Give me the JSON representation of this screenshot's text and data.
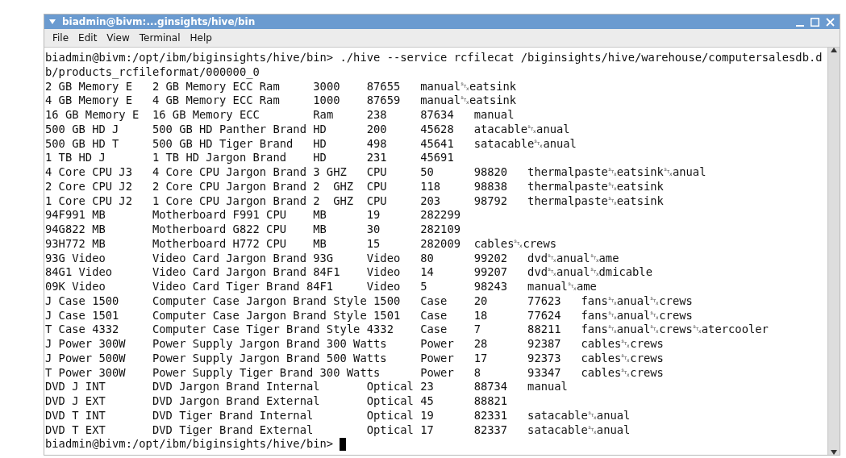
{
  "window": {
    "title": "biadmin@bivm:...ginsights/hive/bin"
  },
  "menu": [
    "File",
    "Edit",
    "View",
    "Terminal",
    "Help"
  ],
  "terminal": {
    "lines": [
      "biadmin@bivm:/opt/ibm/biginsights/hive/bin> ./hive --service rcfilecat /biginsights/hive/warehouse/computersalesdb.d",
      "b/products_rcfileformat/000000_0",
      "2 GB Memory E\t2 GB Memory ECC Ram\t3000\t87655\tmanual␂eatsink",
      "4 GB Memory E\t4 GB Memory ECC Ram\t1000\t87659\tmanual␂eatsink",
      "16 GB Memory E\t16 GB Memory ECC\tRam\t238\t87634\tmanual",
      "500 GB HD J\t500 GB HD Panther Brand\tHD\t200\t45628\tatacable␂anual",
      "500 GB HD T\t500 GB HD Tiger Brand\tHD\t498\t45641\tsatacable␂anual",
      "1 TB HD J\t1 TB HD Jargon Brand\tHD\t231\t45691",
      "4 Core CPU J3\t4 Core CPU Jargon Brand 3 GHZ\tCPU\t50\t98820\tthermalpaste␂eatsink␂anual",
      "2 Core CPU J2\t2 Core CPU Jargon Brand 2  GHZ\tCPU\t118\t98838\tthermalpaste␂eatsink",
      "1 Core CPU J2\t1 Core CPU Jargon Brand 2  GHZ\tCPU\t203\t98792\tthermalpaste␂eatsink",
      "94F991 MB\tMotherboard F991 CPU\tMB\t19\t282299",
      "94G822 MB\tMotherboard G822 CPU\tMB\t30\t282109",
      "93H772 MB\tMotherboard H772 CPU\tMB\t15\t282009\tcables␂crews",
      "93G Video\tVideo Card Jargon Brand 93G\tVideo\t80\t99202\tdvd␂anual␂ame",
      "84G1 Video\tVideo Card Jargon Brand 84F1\tVideo\t14\t99207\tdvd␂anual␂dmicable",
      "09K Video\tVideo Card Tiger Brand 84F1\tVideo\t5\t98243\tmanual␂ame",
      "J Case 1500\tComputer Case Jargon Brand Style 1500\tCase\t20\t77623\tfans␂anual␂crews",
      "J Case 1501\tComputer Case Jargon Brand Style 1501\tCase\t18\t77624\tfans␂anual␂crews",
      "T Case 4332\tComputer Case Tiger Brand Style 4332\tCase\t7\t88211\tfans␂anual␂crews␂atercooler",
      "J Power 300W\tPower Supply Jargon Brand 300 Watts\tPower\t28\t92387\tcables␂crews",
      "J Power 500W\tPower Supply Jargon Brand 500 Watts\tPower\t17\t92373\tcables␂crews",
      "T Power 300W\tPower Supply Tiger Brand 300 Watts\tPower\t8\t93347\tcables␂crews",
      "DVD J INT\tDVD Jargon Brand Internal\tOptical\t23\t88734\tmanual",
      "DVD J EXT\tDVD Jargon Brand External\tOptical\t45\t88821",
      "DVD T INT\tDVD Tiger Brand Internal\tOptical\t19\t82331\tsatacable␂anual",
      "DVD T EXT\tDVD Tiger Brand External\tOptical\t17\t82337\tsatacable␂anual"
    ],
    "prompt": "biadmin@bivm:/opt/ibm/biginsights/hive/bin>"
  }
}
